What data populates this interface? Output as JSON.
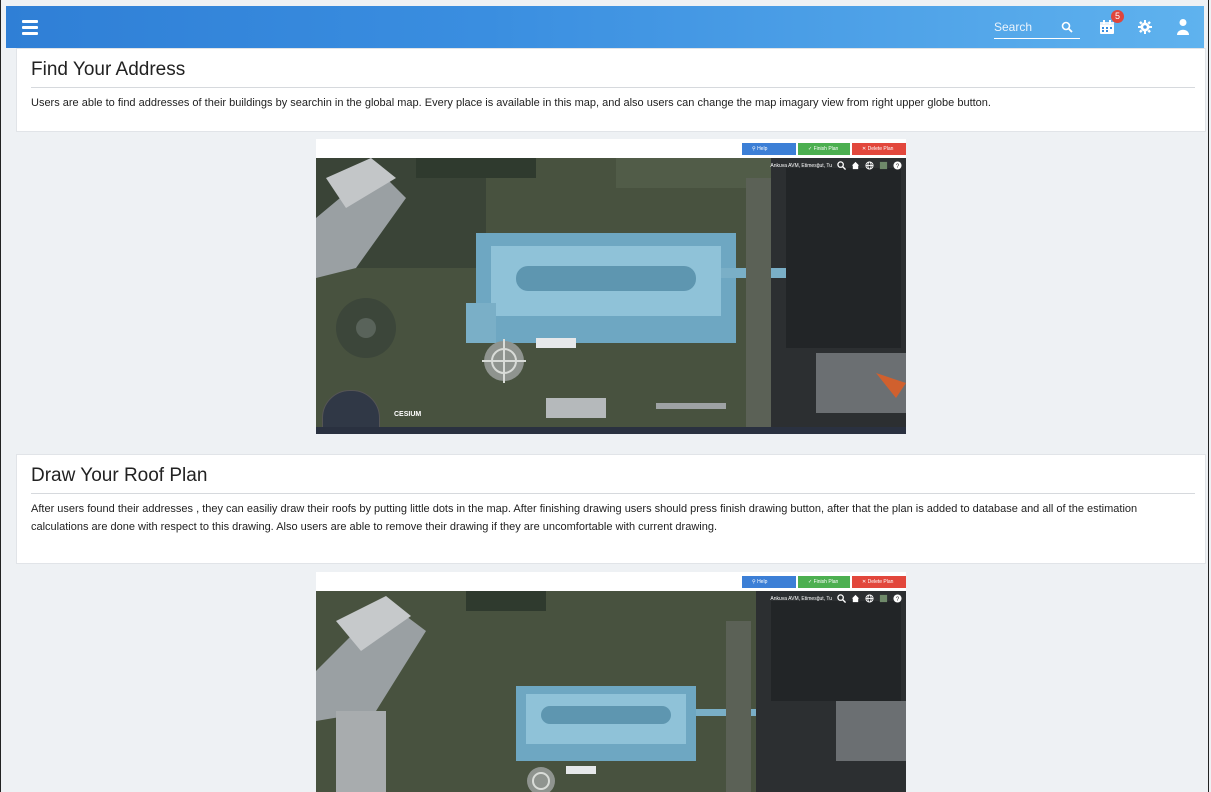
{
  "header": {
    "search_placeholder": "Search",
    "notifications_count": "5",
    "colors": {
      "bar_start": "#2f7fd6",
      "bar_end": "#5fb2ee",
      "badge": "#e0463c"
    }
  },
  "sections": [
    {
      "title": "Find Your Address",
      "text": "Users are able to find addresses of their buildings by searchin in the global map. Every place is available in this map, and also users can change the map imagary view from right upper globe button."
    },
    {
      "title": "Draw Your Roof Plan",
      "text": "After users found their addresses , they can easiliy draw their roofs by putting little dots in the map. After finishing drawing users should press finish drawing button, after that the plan is added to database and all of the estimation calculations are done with respect to this drawing. Also users are able to remove their drawing if they are uncomfortable with current drawing."
    }
  ],
  "screenshot": {
    "help_label": "Help",
    "finish_label": "Finish Plan",
    "delete_label": "Delete Plan",
    "location_text": "Ankuva AVM, Etimesğut, Tu",
    "cesium_label": "CESIUM",
    "colors": {
      "help": "#3c7fd6",
      "finish": "#4caf50",
      "delete": "#e2473c"
    }
  }
}
